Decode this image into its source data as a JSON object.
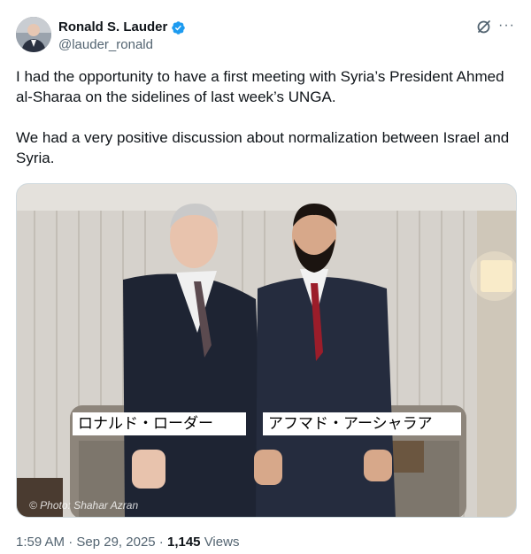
{
  "author": {
    "display_name": "Ronald S. Lauder",
    "handle": "@lauder_ronald",
    "avatar_icon": "avatar-photo",
    "verified_icon": "verified-badge-icon",
    "verified_color": "#1d9bf0"
  },
  "actions": {
    "grok_icon": "grok-icon",
    "more_icon": "more-icon",
    "more_label": "···"
  },
  "post": {
    "paragraphs": [
      "I had the opportunity to have a first meeting with Syria’s President Ahmed al-Sharaa on the sidelines of last week’s UNGA.",
      "We had a very positive discussion about normalization between Israel and Syria."
    ]
  },
  "media": {
    "caption_left": "ロナルド・ローダー",
    "caption_right": "アフマド・アーシャラア",
    "credit": "© Photo: Shahar Azran"
  },
  "meta": {
    "time": "1:59 AM",
    "sep1": " · ",
    "date": "Sep 29, 2025",
    "sep2": " · ",
    "views_count": "1,145",
    "views_label": " Views"
  }
}
